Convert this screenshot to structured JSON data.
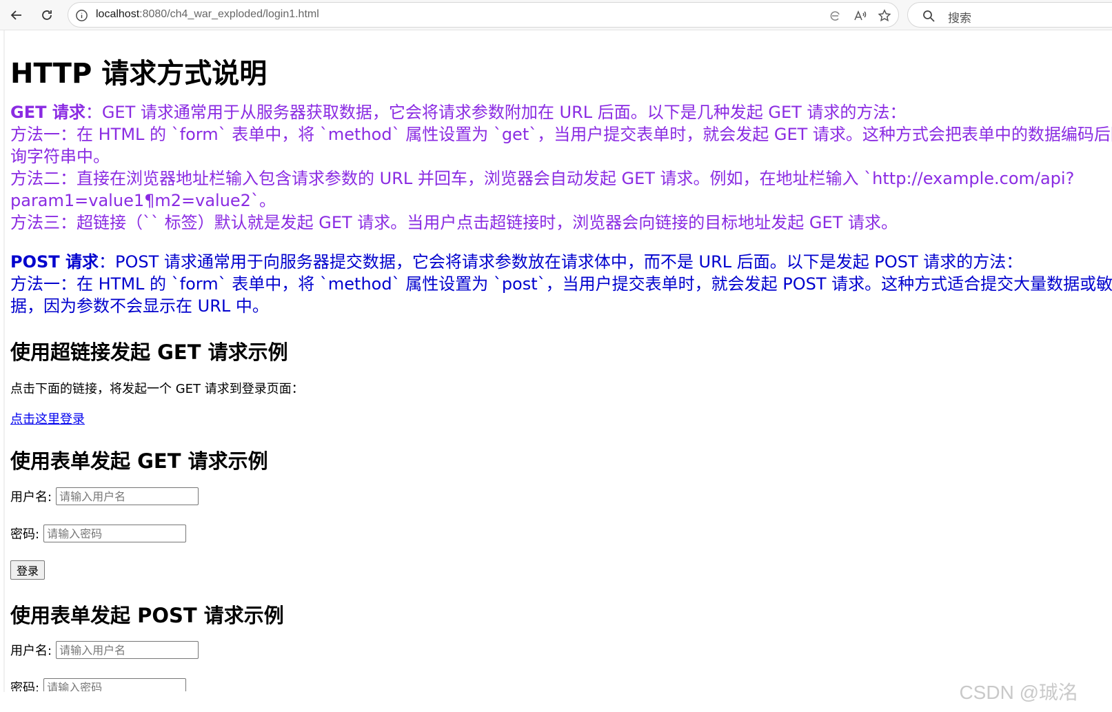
{
  "browser": {
    "url_host": "localhost",
    "url_rest": ":8080/ch4_war_exploded/login1.html",
    "search_placeholder": "搜索"
  },
  "page": {
    "title": "HTTP 请求方式说明",
    "get_section": {
      "label": "GET 请求",
      "intro": "：GET 请求通常用于从服务器获取数据，它会将请求参数附加在 URL 后面。以下是几种发起 GET 请求的方法：",
      "method1_line1": "方法一：在 HTML 的 `form` 表单中，将 `method` 属性设置为 `get`，当用户提交表单时，就会发起 GET 请求。这种方式会把表单中的数据编码后附加在 URL 的查",
      "method1_line2": "询字符串中。",
      "method2_line1": "方法二：直接在浏览器地址栏输入包含请求参数的 URL 并回车，浏览器会自动发起 GET 请求。例如，在地址栏输入 `http://example.com/api?",
      "method2_line2": "param1=value1¶m2=value2`。",
      "method3": "方法三：超链接（`` 标签）默认就是发起 GET 请求。当用户点击超链接时，浏览器会向链接的目标地址发起 GET 请求。"
    },
    "post_section": {
      "label": "POST 请求",
      "intro": "：POST 请求通常用于向服务器提交数据，它会将请求参数放在请求体中，而不是 URL 后面。以下是发起 POST 请求的方法：",
      "method1_line1": "方法一：在 HTML 的 `form` 表单中，将 `method` 属性设置为 `post`，当用户提交表单时，就会发起 POST 请求。这种方式适合提交大量数据或敏感数",
      "method1_line2": "据，因为参数不会显示在 URL 中。"
    },
    "link_example": {
      "heading": "使用超链接发起 GET 请求示例",
      "desc": "点击下面的链接，将发起一个 GET 请求到登录页面：",
      "link_text": "点击这里登录"
    },
    "get_form": {
      "heading": "使用表单发起 GET 请求示例",
      "username_label": "用户名:",
      "username_placeholder": "请输入用户名",
      "password_label": "密码:",
      "password_placeholder": "请输入密码",
      "submit_label": "登录"
    },
    "post_form": {
      "heading": "使用表单发起 POST 请求示例",
      "username_label": "用户名:",
      "username_placeholder": "请输入用户名",
      "password_label": "密码:",
      "password_placeholder": "请输入密码"
    }
  },
  "watermark": "CSDN @珹洺",
  "colors": {
    "get_text": "#8a2be2",
    "post_text": "#0000cd",
    "link": "#0000ee"
  }
}
